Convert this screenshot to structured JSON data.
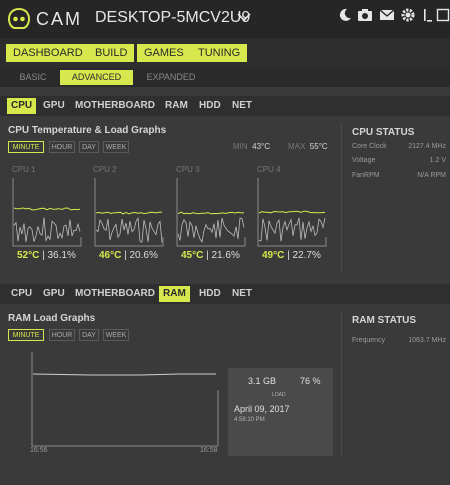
{
  "app": {
    "brand": "CAM",
    "device": "DESKTOP-5MCV2U9"
  },
  "top_icons": [
    "moon-icon",
    "camera-icon",
    "mail-icon",
    "gear-icon",
    "minimize-icon",
    "maximize-icon"
  ],
  "main_tabs": [
    {
      "label": "DASHBOARD",
      "active": true
    },
    {
      "label": "BUILD"
    },
    {
      "label": "GAMES"
    },
    {
      "label": "TUNING"
    }
  ],
  "sub_tabs": [
    {
      "label": "BASIC"
    },
    {
      "label": "ADVANCED",
      "active": true
    },
    {
      "label": "EXPANDED"
    }
  ],
  "cpu_panel": {
    "tabs": [
      {
        "label": "CPU",
        "active": true
      },
      {
        "label": "GPU"
      },
      {
        "label": "MOTHERBOARD"
      },
      {
        "label": "RAM"
      },
      {
        "label": "HDD"
      },
      {
        "label": "NET"
      }
    ],
    "title": "CPU Temperature & Load Graphs",
    "ranges": [
      "MINUTE",
      "HOUR",
      "DAY",
      "WEEK"
    ],
    "min_label": "MIN",
    "min_value": "43°C",
    "max_label": "MAX",
    "max_value": "55°C",
    "cores": [
      {
        "label": "CPU 1",
        "temp": "52°C",
        "load": "36.1%"
      },
      {
        "label": "CPU 2",
        "temp": "46°C",
        "load": "20.6%"
      },
      {
        "label": "CPU 3",
        "temp": "45°C",
        "load": "21.6%"
      },
      {
        "label": "CPU 4",
        "temp": "49°C",
        "load": "22.7%"
      }
    ],
    "status": {
      "title": "CPU STATUS",
      "rows": [
        {
          "label": "Core Clock",
          "value": "2127.4 MHz"
        },
        {
          "label": "Voltage",
          "value": "1.2 V"
        },
        {
          "label": "FanRPM",
          "value": "N/A RPM"
        }
      ]
    }
  },
  "ram_panel": {
    "tabs": [
      {
        "label": "CPU"
      },
      {
        "label": "GPU"
      },
      {
        "label": "MOTHERBOARD"
      },
      {
        "label": "RAM",
        "active": true
      },
      {
        "label": "HDD"
      },
      {
        "label": "NET"
      }
    ],
    "title": "RAM Load Graphs",
    "ranges": [
      "MINUTE",
      "HOUR",
      "DAY",
      "WEEK"
    ],
    "x_start": "16:56",
    "x_end": "16:58",
    "card": {
      "used": "3.1 GB",
      "percent": "76 %",
      "load_label": "LOAD",
      "date": "April 09, 2017",
      "time": "4:58:10 PM"
    },
    "status": {
      "title": "RAM STATUS",
      "rows": [
        {
          "label": "Frequency",
          "value": "1063.7 MHz"
        }
      ]
    }
  },
  "colors": {
    "accent": "#d7e84e",
    "background": "#3a3a3a",
    "topbar": "#262626"
  }
}
